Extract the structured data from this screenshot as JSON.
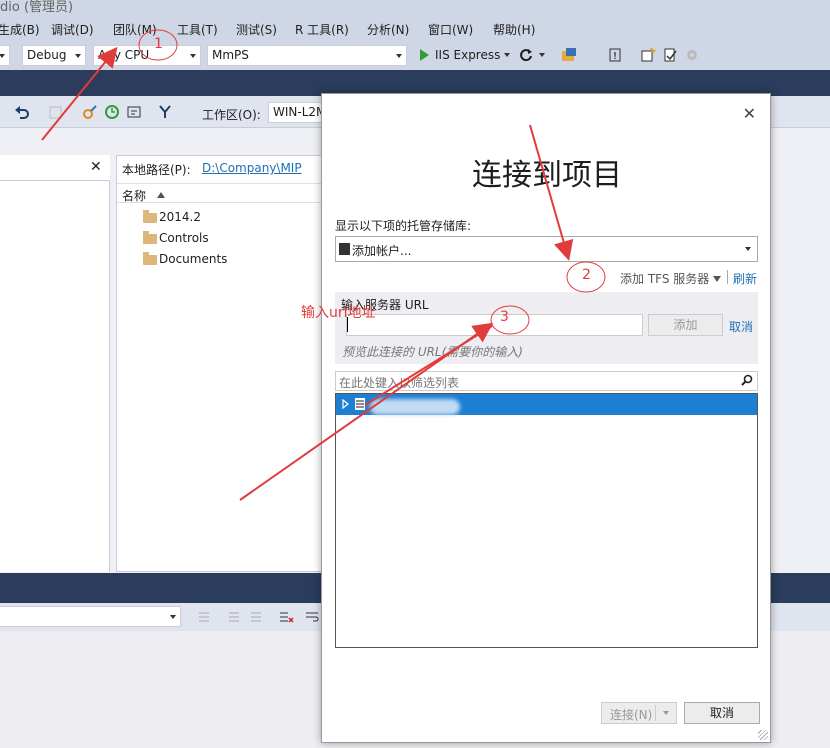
{
  "window": {
    "title": "dio (管理员)"
  },
  "menu": [
    "生成(B)",
    "调试(D)",
    "团队(M)",
    "工具(T)",
    "测试(S)",
    "R 工具(R)",
    "分析(N)",
    "窗口(W)",
    "帮助(H)"
  ],
  "toolbar": {
    "config": "Debug",
    "platform": "Any CPU",
    "startup_project": "MmPS",
    "run_label": "IIS Express"
  },
  "source_control": {
    "workspace_label": "工作区(O):",
    "workspace_value": "WIN-L2M",
    "local_path_label": "本地路径(P):",
    "local_path_value": "D:\\Company\\MIP",
    "column_name": "名称",
    "folders": [
      "2014.2",
      "Controls",
      "Documents"
    ]
  },
  "dialog": {
    "title": "连接到项目",
    "hosted_repos_label": "显示以下项的托管存储库:",
    "account_selector": "添加帐户...",
    "add_tfs_server": "添加 TFS 服务器",
    "refresh": "刷新",
    "server_url_label": "输入服务器 URL",
    "server_url_value": "",
    "add_button": "添加",
    "cancel_link": "取消",
    "preview_hint": "预览此连接的 URL(需要你的输入)",
    "filter_placeholder": "在此处键入以筛选列表",
    "connect_button": "连接(N)",
    "cancel_button": "取消"
  },
  "annotations": {
    "step1": "1",
    "step2": "2",
    "step3": "3",
    "note": "输入url地址",
    "color": "#e03c3c"
  }
}
